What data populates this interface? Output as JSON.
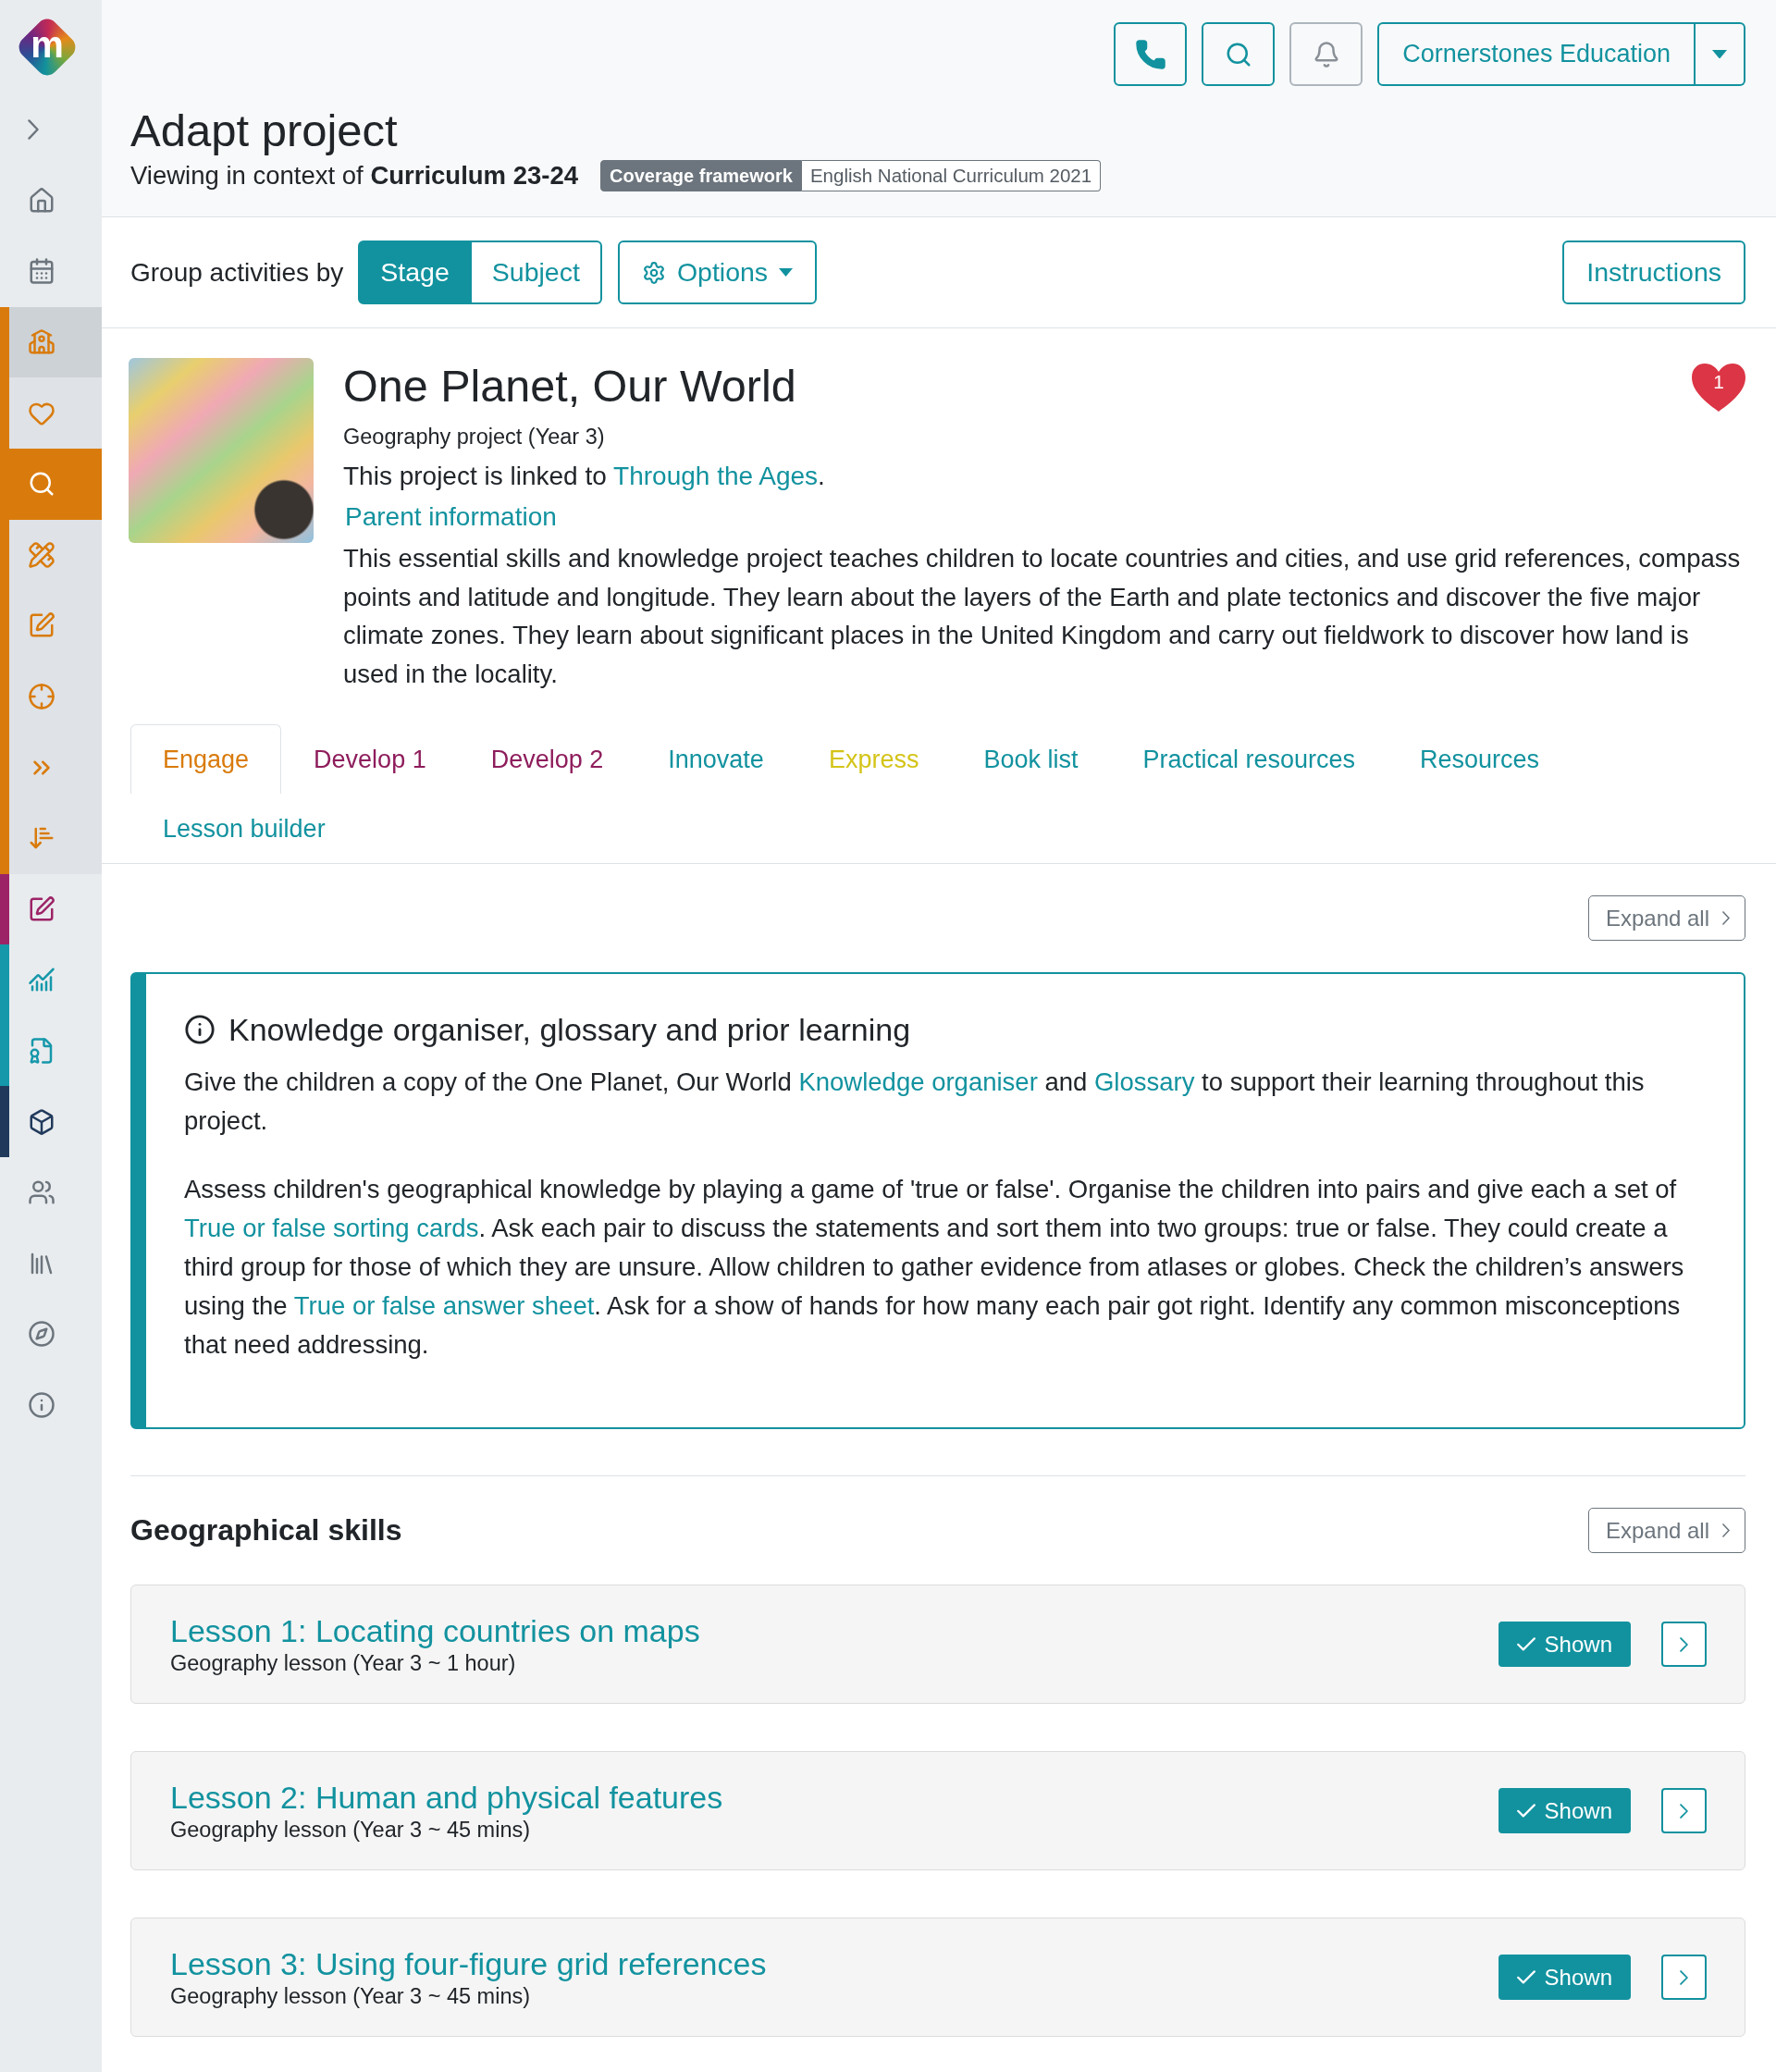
{
  "sidebar": {
    "logo": "m",
    "collapsed": true,
    "items": [
      {
        "kind": "plain",
        "selected": false
      },
      {
        "kind": "plain",
        "selected": false
      },
      {
        "kind": "section",
        "selected": false,
        "color": "#d97b0c"
      },
      {
        "kind": "sub",
        "selected": false,
        "color": "#d97b0c"
      },
      {
        "kind": "sub",
        "selected": true,
        "color": "#d97b0c"
      },
      {
        "kind": "sub",
        "selected": false,
        "color": "#d97b0c"
      },
      {
        "kind": "sub",
        "selected": false,
        "color": "#d97b0c"
      },
      {
        "kind": "sub",
        "selected": false,
        "color": "#d97b0c"
      },
      {
        "kind": "sub",
        "selected": false,
        "color": "#d97b0c"
      },
      {
        "kind": "sub",
        "selected": false,
        "color": "#d97b0c"
      },
      {
        "kind": "plain",
        "selected": false,
        "color": "#9c2466"
      },
      {
        "kind": "plain",
        "selected": false,
        "color": "#1598aa"
      },
      {
        "kind": "plain",
        "selected": false,
        "color": "#1598aa"
      },
      {
        "kind": "plain",
        "selected": false,
        "color": "#213a5c"
      },
      {
        "kind": "plain",
        "selected": false
      },
      {
        "kind": "plain",
        "selected": false
      },
      {
        "kind": "plain",
        "selected": false
      },
      {
        "kind": "plain",
        "selected": false
      }
    ]
  },
  "header": {
    "icon_buttons": [
      {
        "disabled": false
      },
      {
        "disabled": false
      },
      {
        "disabled": true
      }
    ],
    "account": "Cornerstones Education",
    "title": "Adapt project",
    "context": "Viewing in context of **Curriculum 23-24**",
    "framework_label": "Coverage framework",
    "framework_value": "English National Curriculum 2021"
  },
  "toolbar": {
    "group_label": "Group activities by",
    "group_options": [
      {
        "label": "Stage",
        "selected": true
      },
      {
        "label": "Subject",
        "selected": false
      }
    ],
    "options_button": "Options",
    "instructions_button": "Instructions"
  },
  "project": {
    "title": "One Planet, Our World",
    "favourites": "1",
    "subtitle": "Geography project (Year 3)",
    "linked": [
      {
        "kind": "text",
        "text": "This project is linked to "
      },
      {
        "kind": "link",
        "text": "Through the Ages"
      },
      {
        "kind": "text",
        "text": "."
      }
    ],
    "parent_link": "Parent information",
    "description": "This essential skills and knowledge project teaches children to locate countries and cities, and use grid references, compass points and latitude and longitude. They learn about the layers of the Earth and plate tectonics and discover the five major climate zones. They learn about significant places in the United Kingdom and carry out fieldwork to discover how land is used in the locality."
  },
  "tabs": [
    {
      "label": "Engage",
      "color": "#d97b0c",
      "selected": true
    },
    {
      "label": "Develop 1",
      "color": "#8e1d5c",
      "selected": false
    },
    {
      "label": "Develop 2",
      "color": "#8e1d5c",
      "selected": false
    },
    {
      "label": "Innovate",
      "color": "#12929f",
      "selected": false
    },
    {
      "label": "Express",
      "color": "#d4c418",
      "selected": false
    },
    {
      "label": "Book list",
      "color": "#12929f",
      "selected": false
    },
    {
      "label": "Practical resources",
      "color": "#12929f",
      "selected": false
    },
    {
      "label": "Resources",
      "color": "#12929f",
      "selected": false
    },
    {
      "label": "Lesson builder",
      "color": "#12929f",
      "selected": false
    }
  ],
  "engage": {
    "expand_label": "Expand all",
    "callout": {
      "title": "Knowledge organiser, glossary and prior learning",
      "paragraphs": [
        [
          {
            "kind": "text",
            "text": "Give the children a copy of the One Planet, Our World "
          },
          {
            "kind": "link",
            "text": "Knowledge organiser"
          },
          {
            "kind": "text",
            "text": " and "
          },
          {
            "kind": "link",
            "text": "Glossary"
          },
          {
            "kind": "text",
            "text": " to support their learning throughout this project."
          }
        ],
        [
          {
            "kind": "text",
            "text": "Assess children's geographical knowledge by playing a game of 'true or false'. Organise the children into pairs and give each a set of "
          },
          {
            "kind": "link",
            "text": "True or false sorting cards"
          },
          {
            "kind": "text",
            "text": ". Ask each pair to discuss the statements and sort them into two groups: true or false. They could create a third group for those of which they are unsure. Allow children to gather evidence from atlases or globes. Check the children’s answers using the "
          },
          {
            "kind": "link",
            "text": "True or false answer sheet"
          },
          {
            "kind": "text",
            "text": ". Ask for a show of hands for how many each pair got right. Identify any common misconceptions that need addressing."
          }
        ]
      ]
    }
  },
  "skills": {
    "title": "Geographical skills",
    "expand_label": "Expand all",
    "lessons": [
      {
        "title": "Lesson 1: Locating countries on maps",
        "subtitle": "Geography lesson (Year 3 ~ 1 hour)",
        "status": "Shown",
        "shown": true
      },
      {
        "title": "Lesson 2: Human and physical features",
        "subtitle": "Geography lesson (Year 3 ~ 45 mins)",
        "status": "Shown",
        "shown": true
      },
      {
        "title": "Lesson 3: Using four-figure grid references",
        "subtitle": "Geography lesson (Year 3 ~ 45 mins)",
        "status": "Shown",
        "shown": true
      }
    ]
  }
}
